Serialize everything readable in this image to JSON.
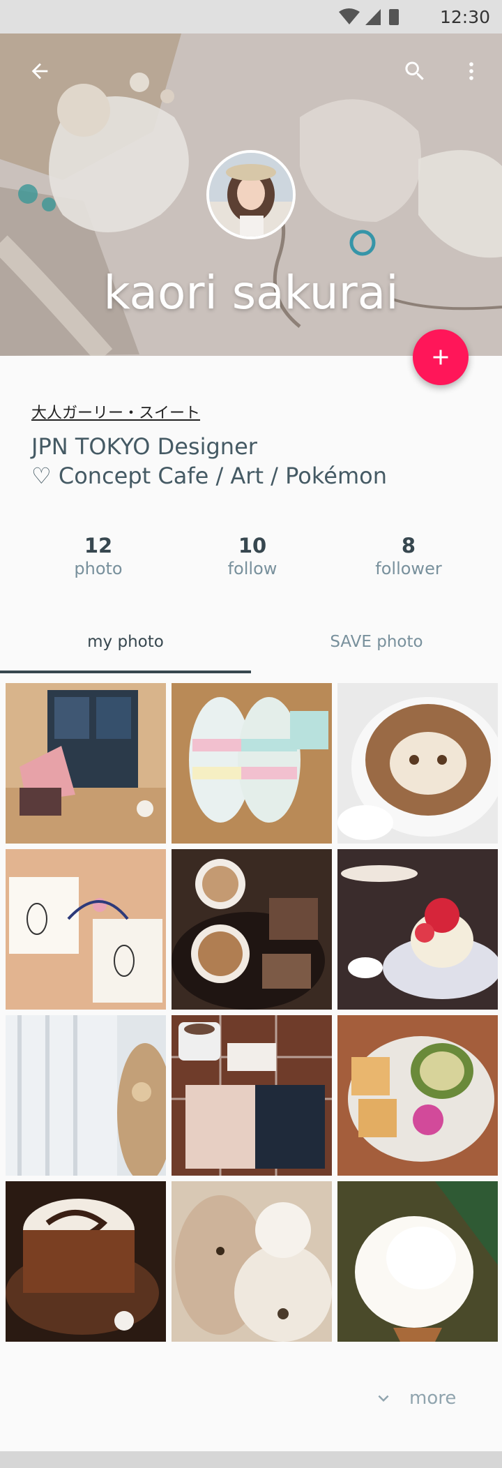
{
  "status_bar": {
    "time": "12:30",
    "icons": [
      "wifi-icon",
      "cell-signal-icon",
      "battery-icon"
    ]
  },
  "header": {
    "name": "kaori sakurai",
    "icons": {
      "back": "arrow-back-icon",
      "search": "search-icon",
      "menu": "more-vert-icon"
    }
  },
  "fab": {
    "icon": "plus-icon",
    "color": "#ff1659"
  },
  "profile": {
    "tagline": "大人ガーリー・スイート",
    "bio_line1": "JPN TOKYO  Designer",
    "bio_line2": "♡ Concept Cafe / Art / Pokémon"
  },
  "stats": [
    {
      "value": "12",
      "label": "photo"
    },
    {
      "value": "10",
      "label": "follow"
    },
    {
      "value": "8",
      "label": "follower"
    }
  ],
  "tabs": [
    {
      "label": "my photo",
      "active": true
    },
    {
      "label": "SAVE photo",
      "active": false
    }
  ],
  "photos": [
    {
      "name": "window-stuffed-animals"
    },
    {
      "name": "pastel-slippers"
    },
    {
      "name": "cat-latte-art"
    },
    {
      "name": "rabbit-tote-bags"
    },
    {
      "name": "cafe-lattes"
    },
    {
      "name": "strawberry-cake"
    },
    {
      "name": "lace-curtain-plush"
    },
    {
      "name": "coffee-notebooks"
    },
    {
      "name": "crackers-soup"
    },
    {
      "name": "chocolate-latte"
    },
    {
      "name": "plush-toys"
    },
    {
      "name": "white-angora-rabbit"
    }
  ],
  "more": {
    "label": "more",
    "icon": "chevron-down-icon"
  },
  "colors": {
    "accent": "#ff1659",
    "text": "#37474f",
    "muted": "#78909c"
  }
}
